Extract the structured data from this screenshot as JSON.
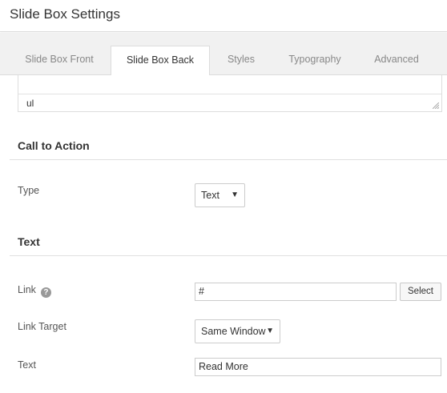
{
  "window": {
    "title": "Slide Box Settings"
  },
  "tabs": [
    {
      "label": "Slide Box Front",
      "active": false
    },
    {
      "label": "Slide Box Back",
      "active": true
    },
    {
      "label": "Styles",
      "active": false
    },
    {
      "label": "Typography",
      "active": false
    },
    {
      "label": "Advanced",
      "active": false
    }
  ],
  "editor": {
    "last_line": "ul"
  },
  "call_to_action": {
    "heading": "Call to Action",
    "type_label": "Type",
    "type_value": "Text"
  },
  "text_section": {
    "heading": "Text",
    "link_label": "Link",
    "link_value": "#",
    "select_button": "Select",
    "link_target_label": "Link Target",
    "link_target_value": "Same Window",
    "text_label": "Text",
    "text_value": "Read More"
  },
  "icons": {
    "help": "question-circle-icon",
    "dropdown": "caret-down-icon",
    "resize": "resize-grip-icon"
  },
  "colors": {
    "accent_bg": "#f1f1f1",
    "border": "#dcdcdc"
  }
}
